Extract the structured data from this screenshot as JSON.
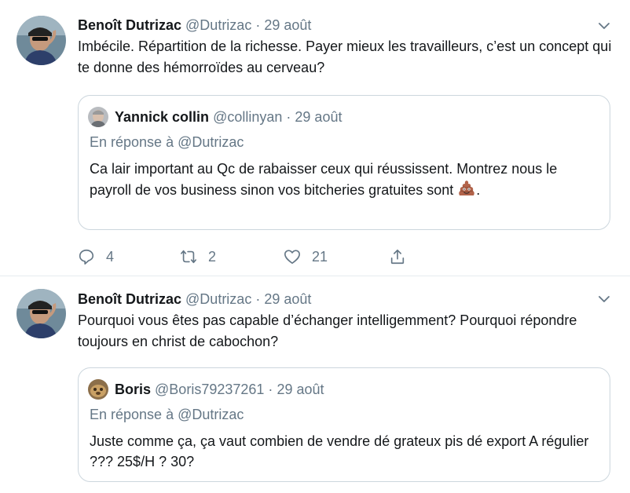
{
  "tweets": [
    {
      "author_name": "Benoît Dutrizac",
      "author_handle": "@Dutrizac",
      "separator": "·",
      "date": "29 août",
      "text": "Imbécile. Répartition de la richesse. Payer mieux les travailleurs, c’est un concept qui te donne des hémorroïdes au cerveau?",
      "quoted": {
        "author_name": "Yannick collin",
        "author_handle": "@collinyan",
        "separator": "·",
        "date": "29 août",
        "reply_prefix": "En réponse à",
        "reply_to": "@Dutrizac",
        "text": "Ca lair important au Qc de rabaisser ceux qui réussissent. Montrez nous le payroll de vos business sinon vos bitcheries gratuites sont",
        "text_suffix": ".",
        "emoji": "poop-emoji"
      },
      "actions": {
        "reply_count": "4",
        "retweet_count": "2",
        "like_count": "21"
      }
    },
    {
      "author_name": "Benoît Dutrizac",
      "author_handle": "@Dutrizac",
      "separator": "·",
      "date": "29 août",
      "text": "Pourquoi vous êtes pas capable d’échanger intelligemment? Pourquoi répondre toujours en christ de cabochon?",
      "quoted": {
        "author_name": "Boris",
        "author_handle": "@Boris79237261",
        "separator": "·",
        "date": "29 août",
        "reply_prefix": "En réponse à",
        "reply_to": "@Dutrizac",
        "text": "Juste comme ça, ça vaut combien de vendre dé grateux pis dé export A régulier ??? 25$/H ? 30?"
      }
    }
  ],
  "colors": {
    "text": "#14171a",
    "secondary": "#657786",
    "border": "#ccd6dd",
    "divider": "#e6ecf0"
  },
  "icons": [
    "chevron-down-icon",
    "reply-icon",
    "retweet-icon",
    "like-icon",
    "share-icon",
    "poop-emoji"
  ]
}
